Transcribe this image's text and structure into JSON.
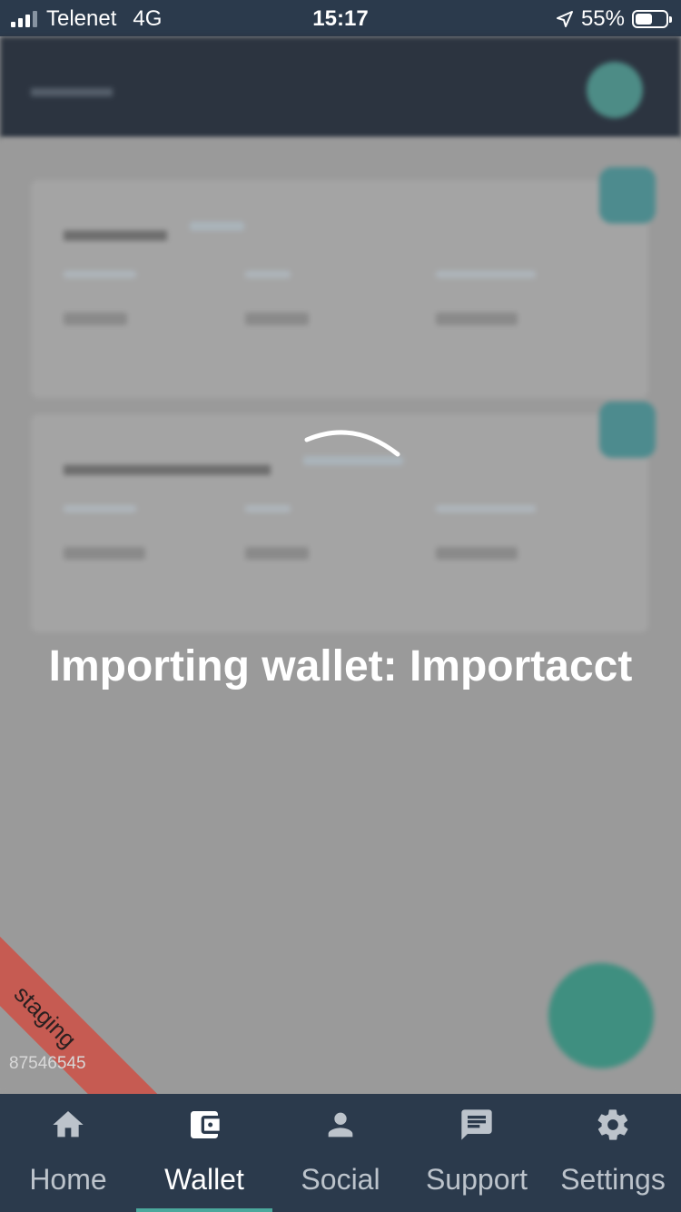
{
  "status_bar": {
    "carrier": "Telenet",
    "network": "4G",
    "time": "15:17",
    "battery_percent": "55%",
    "battery_level": 0.55
  },
  "overlay": {
    "message": "Importing wallet: Importacct"
  },
  "ribbon": {
    "label": "staging",
    "build": "87546545"
  },
  "bottom_nav": {
    "items": [
      {
        "label": "Home",
        "icon": "home-icon"
      },
      {
        "label": "Wallet",
        "icon": "wallet-icon",
        "active": true
      },
      {
        "label": "Social",
        "icon": "person-icon"
      },
      {
        "label": "Support",
        "icon": "chat-icon"
      },
      {
        "label": "Settings",
        "icon": "gear-icon"
      }
    ]
  },
  "colors": {
    "header_bg": "#2b3a4c",
    "active_indicator": "#4ba89c",
    "ribbon": "#c65b52"
  }
}
